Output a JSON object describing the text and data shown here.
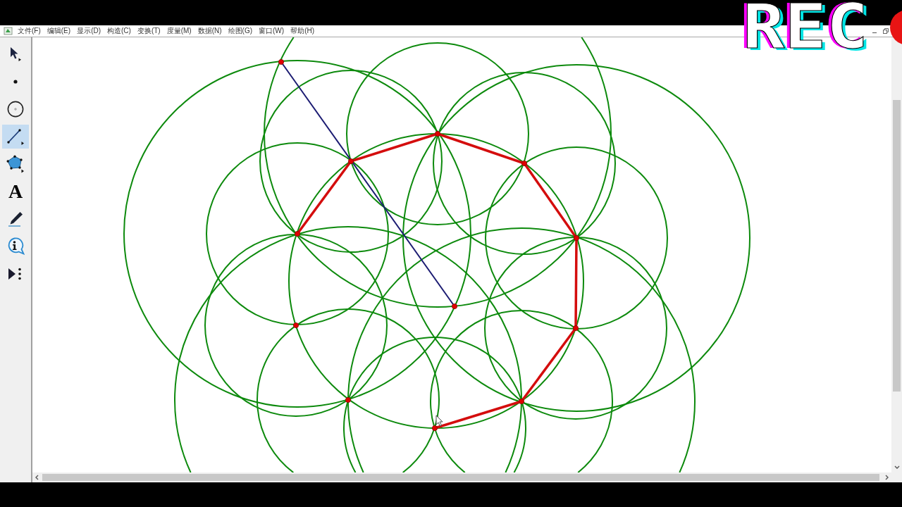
{
  "menu_bar": {
    "items": [
      "文件(F)",
      "编辑(E)",
      "显示(D)",
      "构造(C)",
      "变换(T)",
      "度量(M)",
      "数据(N)",
      "绘图(G)",
      "窗口(W)",
      "帮助(H)"
    ]
  },
  "toolbox": {
    "tools": [
      {
        "kind": "arrow",
        "selected": false
      },
      {
        "kind": "point",
        "selected": false
      },
      {
        "kind": "compass",
        "selected": false
      },
      {
        "kind": "straightedge",
        "selected": true
      },
      {
        "kind": "polygon",
        "selected": false
      },
      {
        "kind": "text",
        "glyph": "A",
        "selected": false
      },
      {
        "kind": "marker",
        "selected": false
      },
      {
        "kind": "info",
        "selected": false
      },
      {
        "kind": "custom",
        "selected": false
      }
    ]
  },
  "recording_indicator": {
    "label": "REC"
  }
}
